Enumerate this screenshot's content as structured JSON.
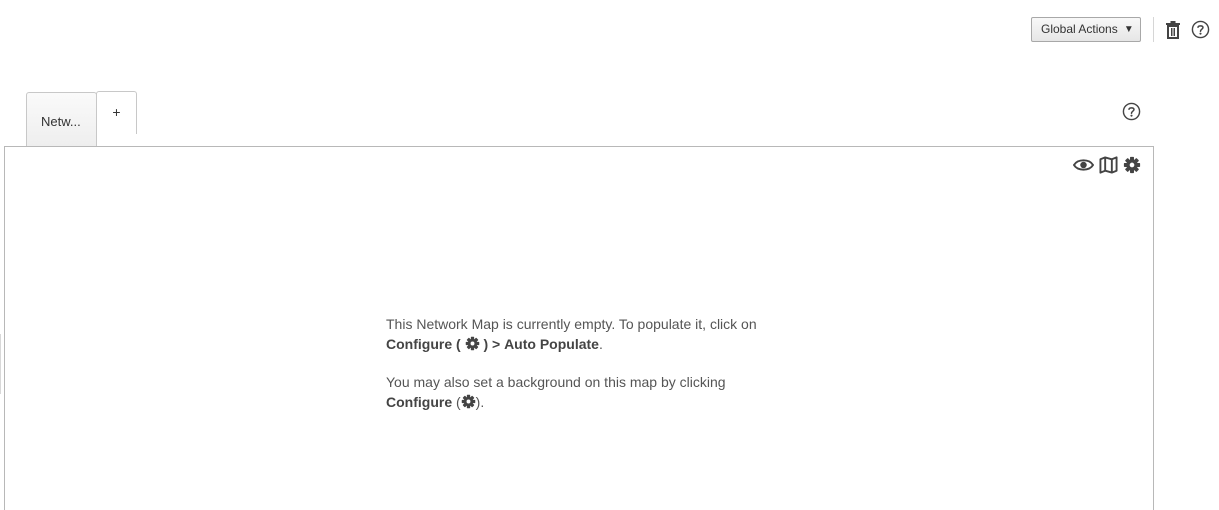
{
  "toolbar": {
    "global_actions_label": "Global Actions",
    "global_actions_caret": "▼",
    "icons": [
      "trash-icon",
      "help-icon"
    ]
  },
  "tabs": [
    {
      "label": "Netw..."
    },
    {
      "label": "+"
    }
  ],
  "map_panel": {
    "icons": [
      "eye-icon",
      "map-icon",
      "gear-icon"
    ],
    "empty_message": {
      "line1_text": "This Network Map is currently empty. To populate it, click on",
      "line1_configure": "Configure (",
      "line1_close": ") >",
      "line1_auto_populate": "Auto Populate",
      "line1_end": ".",
      "line2_text": "You may also set a background on this map by clicking",
      "line2_configure": "Configure",
      "line2_open": "(",
      "line2_end": ")."
    }
  },
  "colors": {
    "text": "#555555",
    "border": "#b8b8b8",
    "icon": "#444444"
  }
}
